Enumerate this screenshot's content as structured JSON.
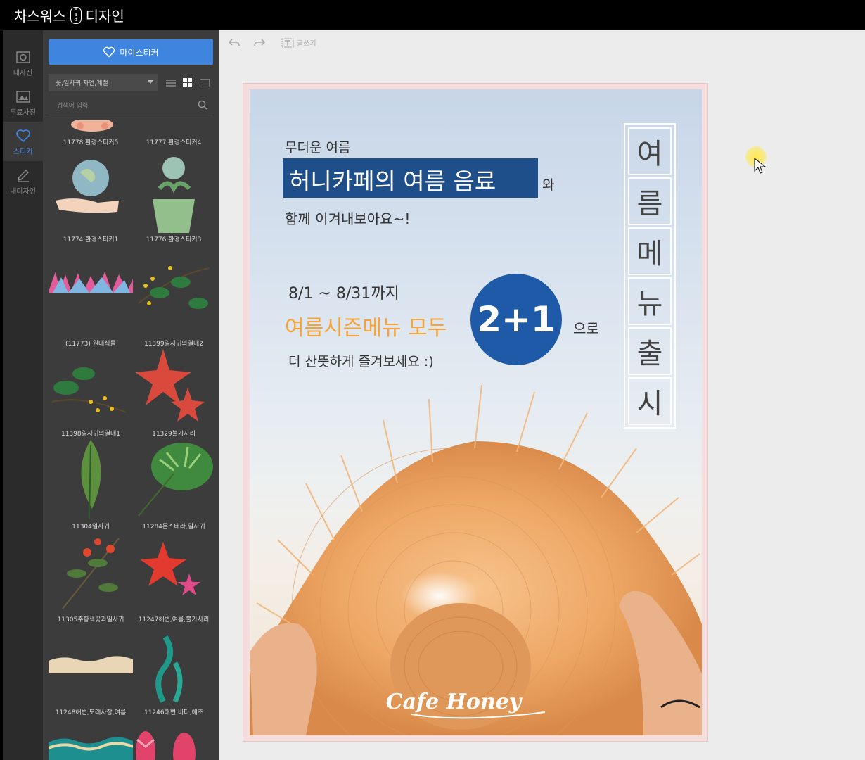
{
  "app": {
    "title_left": "차스워스",
    "logo": "ead",
    "title_right": "디자인"
  },
  "iconbar": [
    {
      "label": "내사진",
      "icon": "camera-icon"
    },
    {
      "label": "무료사진",
      "icon": "free-photo-icon"
    },
    {
      "label": "스티커",
      "icon": "heart-icon"
    },
    {
      "label": "내디자인",
      "icon": "pencil-icon"
    }
  ],
  "panel": {
    "my_sticker_label": "마이스티커",
    "category_value": "꽃,일사귀,자연,계절",
    "search_placeholder": "검색어 입력",
    "stickers": [
      {
        "label": "11778 환경스티커5",
        "icon": "flowers-sticker"
      },
      {
        "label": "11777 환경스티커4",
        "icon": "flowers-sticker"
      },
      {
        "label": "11774 환경스티커1",
        "icon": "earth-hand-sticker"
      },
      {
        "label": "11776 환경스티커3",
        "icon": "earth-pot-sticker"
      },
      {
        "label": "(11773) 원대식물",
        "icon": "leaves-border-sticker"
      },
      {
        "label": "11399일사귀와열매2",
        "icon": "branch-berries-sticker"
      },
      {
        "label": "11398일사귀와열매1",
        "icon": "branch-berries-sticker"
      },
      {
        "label": "11329불가사리",
        "icon": "starfish-sticker"
      },
      {
        "label": "11304일사귀",
        "icon": "leaf-sticker"
      },
      {
        "label": "11284몬스테라,일사귀",
        "icon": "monstera-sticker"
      },
      {
        "label": "11305주황색꽃과일사귀",
        "icon": "orange-flower-sticker"
      },
      {
        "label": "11247해변,여름,불가사리",
        "icon": "starfish-sticker"
      },
      {
        "label": "11248해변,모래사장,여름",
        "icon": "sand-sticker"
      },
      {
        "label": "11246해변,바다,해초",
        "icon": "seaweed-sticker"
      },
      {
        "label": "",
        "icon": "waves-sticker"
      },
      {
        "label": "",
        "icon": "flip-flops-sticker"
      }
    ]
  },
  "toolbar": {
    "undo": "undo-icon",
    "redo": "redo-icon",
    "text_label": "글쓰기"
  },
  "poster": {
    "line1": "무더운 여름",
    "highlight": "허니카페의 여름 음료",
    "wa": "와",
    "line3": "함께 이겨내보아요~!",
    "period": "8/1 ~ 8/31까지",
    "menu_all": "여름시즌메뉴 모두",
    "badge": "2+1",
    "euro": "으로",
    "enjoy": "더 산뜻하게 즐겨보세요 :)",
    "vertical": [
      "여",
      "름",
      "메",
      "뉴",
      "출",
      "시"
    ],
    "brand": "Cafe Honey",
    "colors": {
      "accent_orange": "#f5a335",
      "navy": "#1f4f8b",
      "badge_blue": "#1e5aa8"
    }
  }
}
